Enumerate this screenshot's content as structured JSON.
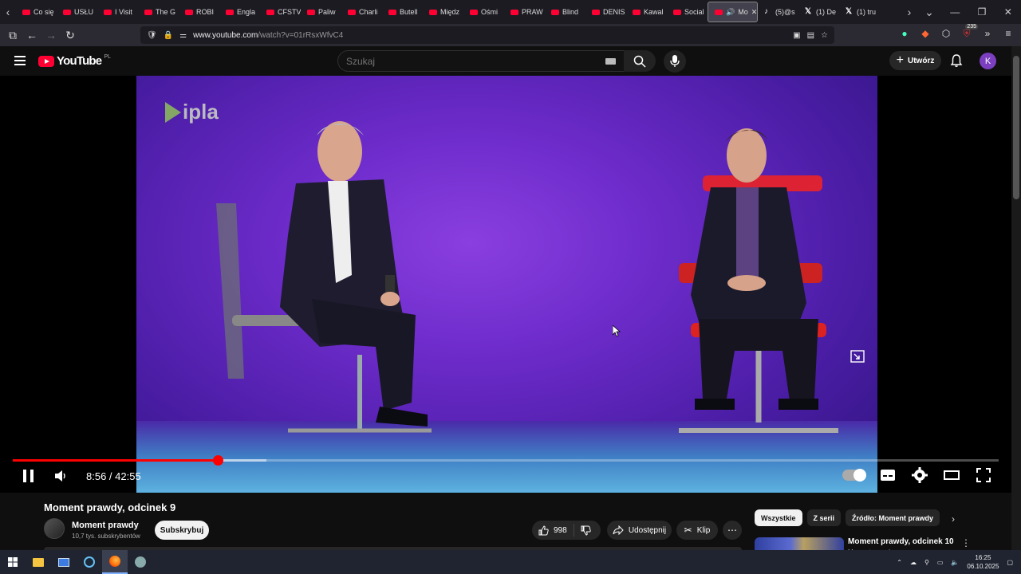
{
  "browser": {
    "tabs": [
      {
        "label": "Co się",
        "icon": "youtube-icon"
      },
      {
        "label": "USŁU",
        "icon": "youtube-icon"
      },
      {
        "label": "I Visit",
        "icon": "youtube-icon"
      },
      {
        "label": "The G",
        "icon": "youtube-icon"
      },
      {
        "label": "ROBI",
        "icon": "youtube-icon"
      },
      {
        "label": "Engla",
        "icon": "youtube-icon"
      },
      {
        "label": "CFSTV",
        "icon": "youtube-icon"
      },
      {
        "label": "Paliw",
        "icon": "youtube-icon"
      },
      {
        "label": "Charli",
        "icon": "youtube-icon"
      },
      {
        "label": "Butell",
        "icon": "youtube-icon"
      },
      {
        "label": "Międz",
        "icon": "youtube-icon"
      },
      {
        "label": "Ośmi",
        "icon": "youtube-icon"
      },
      {
        "label": "PRAW",
        "icon": "youtube-icon"
      },
      {
        "label": "Blind",
        "icon": "youtube-icon"
      },
      {
        "label": "DENIS",
        "icon": "youtube-icon"
      },
      {
        "label": "Kawal",
        "icon": "youtube-icon"
      },
      {
        "label": "Social",
        "icon": "youtube-icon"
      }
    ],
    "active_tab": {
      "label": "Mo",
      "icon": "youtube-icon"
    },
    "extra_tabs": [
      {
        "label": "(5)@s",
        "icon": "tiktok-icon"
      },
      {
        "label": "(1) De",
        "icon": "x-icon"
      },
      {
        "label": "(1) tru",
        "icon": "x-icon"
      }
    ],
    "url": {
      "host": "www.youtube.com",
      "path": "/watch?v=01rRsxWfvC4"
    },
    "badge_count": "235"
  },
  "youtube": {
    "logo_text": "YouTube",
    "region": "PL",
    "search_placeholder": "Szukaj",
    "create_label": "Utwórz",
    "avatar_letter": "K",
    "accent": "#ff0033"
  },
  "player": {
    "watermark": "ipla",
    "time_current": "8:56",
    "time_separator": " / ",
    "time_total": "42:55",
    "progress_played": 0.208,
    "progress_loaded": 0.257
  },
  "video": {
    "title": "Moment prawdy, odcinek 9",
    "channel": "Moment prawdy",
    "subscribers": "10,7 tys. subskrybentów",
    "subscribe_label": "Subskrybuj",
    "likes": "998",
    "share_label": "Udostępnij",
    "clip_label": "Klip"
  },
  "sidebar": {
    "chips": [
      "Wszystkie",
      "Z serii",
      "Źródło: Moment prawdy"
    ],
    "rec_title": "Moment prawdy, odcinek 10",
    "rec_channel": "Moment prawdy"
  },
  "taskbar": {
    "time": "16:25",
    "date": "06.10.2025"
  }
}
